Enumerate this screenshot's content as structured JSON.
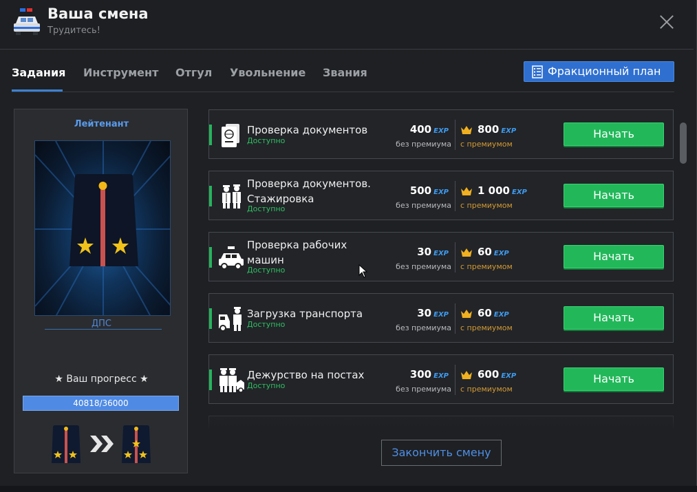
{
  "header": {
    "title": "Ваша смена",
    "subtitle": "Трудитесь!"
  },
  "tabs": [
    {
      "label": "Задания",
      "active": true
    },
    {
      "label": "Инструмент",
      "active": false
    },
    {
      "label": "Отгул",
      "active": false
    },
    {
      "label": "Увольнение",
      "active": false
    },
    {
      "label": "Звания",
      "active": false
    }
  ],
  "plan_button": {
    "label": "Фракционный план",
    "icon": "checklist-icon"
  },
  "rank": {
    "name": "Лейтенант",
    "department": "ДПС",
    "progress_label": "★ Ваш прогресс ★",
    "progress_current": 40818,
    "progress_max": 36000,
    "progress_text": "40818/36000"
  },
  "common": {
    "without_premium": "без премиума",
    "with_premium": "с премиумом",
    "exp_tag": "EXP",
    "start_label": "Начать",
    "accent": "#22b85a"
  },
  "tasks": [
    {
      "title": "Проверка документов",
      "status": "Доступно",
      "exp": "400",
      "exp_premium": "800",
      "icon": "passport-icon"
    },
    {
      "title": "Проверка документов. Стажировка",
      "status": "Доступно",
      "exp": "500",
      "exp_premium": "1 000",
      "icon": "officers-icon"
    },
    {
      "title": "Проверка рабочих машин",
      "status": "Доступно",
      "exp": "30",
      "exp_premium": "60",
      "icon": "police-car-icon"
    },
    {
      "title": "Загрузка транспорта",
      "status": "Доступно",
      "exp": "30",
      "exp_premium": "60",
      "icon": "tow-officer-icon"
    },
    {
      "title": "Дежурство на постах",
      "status": "Доступно",
      "exp": "300",
      "exp_premium": "600",
      "icon": "patrol-post-icon"
    }
  ],
  "finish_button": {
    "label": "Закончить смену"
  }
}
